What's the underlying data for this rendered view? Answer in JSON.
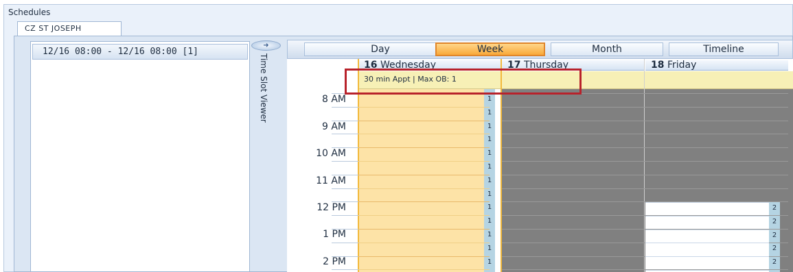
{
  "panel": {
    "title": "Schedules"
  },
  "tabs": [
    {
      "label": "CZ ST JOSEPH"
    }
  ],
  "left_list": {
    "items": [
      {
        "label": "12/16 08:00 - 12/16 08:00  [1]"
      }
    ]
  },
  "side": {
    "toggle_icon": "arrow-right-icon",
    "vertical_label": "Time Slot Viewer"
  },
  "views": {
    "buttons": [
      {
        "label": "Day"
      },
      {
        "label": "Week"
      },
      {
        "label": "Month"
      },
      {
        "label": "Timeline"
      }
    ],
    "active": "Week"
  },
  "days": [
    {
      "num": "16",
      "name": "Wednesday"
    },
    {
      "num": "17",
      "name": "Thursday"
    },
    {
      "num": "18",
      "name": "Friday"
    }
  ],
  "allday": {
    "text": "30 min Appt | Max OB: 1"
  },
  "times": [
    "8 AM",
    "9 AM",
    "10 AM",
    "11 AM",
    "12 PM",
    "1 PM",
    "2 PM"
  ],
  "slots": {
    "wednesday": [
      "1",
      "1",
      "1",
      "1",
      "1",
      "1",
      "1",
      "1",
      "1",
      "1",
      "1",
      "1",
      "1"
    ],
    "friday": [
      "2",
      "2",
      "2",
      "2",
      "2"
    ]
  },
  "colors": {
    "accent_orange": "#f9a93a",
    "available": "#fde3a7",
    "unavailable": "#808080",
    "slot_marker": "#b5d4e3",
    "highlight_box": "#b8222b",
    "allday_bar": "#f7f0b6"
  }
}
